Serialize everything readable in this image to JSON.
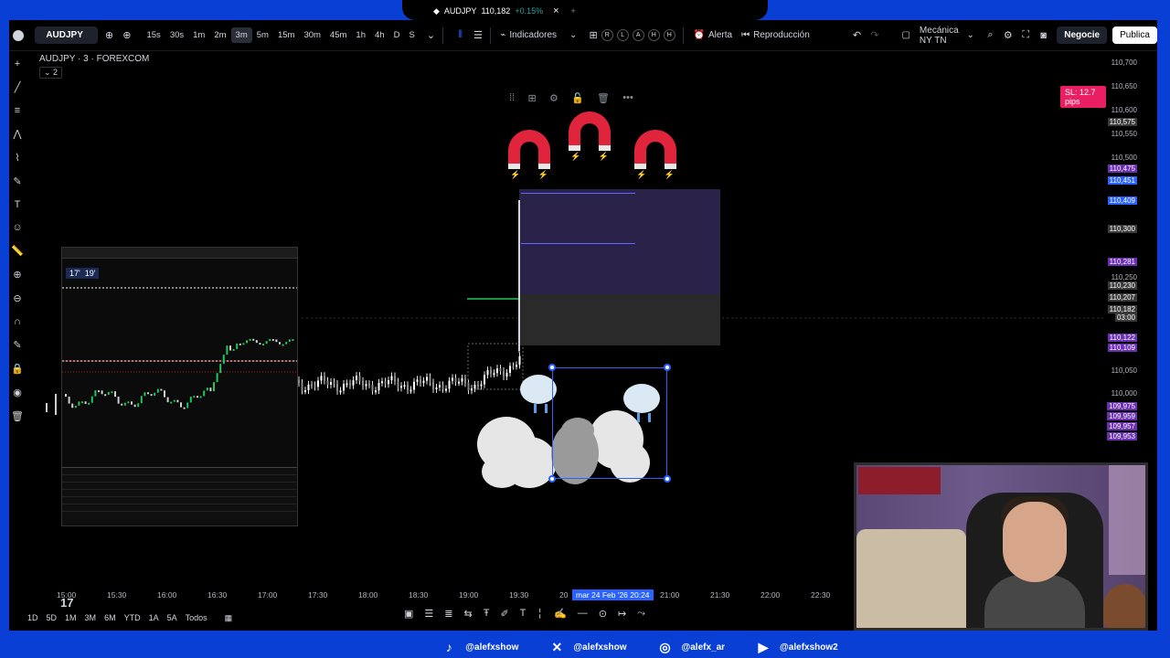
{
  "browser_tab": {
    "title": "AUDJPY",
    "price": "110,182",
    "change": "+0.15%",
    "close_icon": "close-icon",
    "new_tab_icon": "plus-icon"
  },
  "toolbar": {
    "symbol": "AUDJPY",
    "intervals": [
      "15s",
      "30s",
      "1m",
      "2m",
      "3m",
      "5m",
      "15m",
      "30m",
      "45m",
      "1h",
      "4h",
      "D",
      "S"
    ],
    "active_interval": "3m",
    "indicators_label": "Indicadores",
    "small_buttons": [
      "R",
      "L",
      "A",
      "H",
      "H"
    ],
    "alert_label": "Alerta",
    "replay_label": "Reproducción",
    "layout_label": "Mecánica NY TN",
    "trade_label": "Negocie",
    "publish_label": "Publica"
  },
  "chart": {
    "title": "AUDJPY · 3 · FOREXCOM",
    "sub_label": "2",
    "sl_badge": "SL: 12.7 pips"
  },
  "price_axis": {
    "labels": [
      "110,700",
      "110,650",
      "110,600",
      "110,550",
      "110,500",
      "110,350",
      "110,250",
      "110,050",
      "110,000"
    ],
    "tags": [
      {
        "value": "110,575",
        "color": "#3a3a3a"
      },
      {
        "value": "110,475",
        "color": "#6a2fb3"
      },
      {
        "value": "110,451",
        "color": "#2962ff"
      },
      {
        "value": "110,409",
        "color": "#2962ff"
      },
      {
        "value": "110,300",
        "color": "#3a3a3a"
      },
      {
        "value": "110,281",
        "color": "#6a2fb3"
      },
      {
        "value": "110,230",
        "color": "#3a3a3a"
      },
      {
        "value": "110,207",
        "color": "#3a3a3a"
      },
      {
        "value": "110,182",
        "color": "#3a3a3a"
      },
      {
        "value": "03:00",
        "color": "#3a3a3a"
      },
      {
        "value": "110,122",
        "color": "#6a2fb3"
      },
      {
        "value": "110,109",
        "color": "#6a2fb3"
      },
      {
        "value": "109,975",
        "color": "#6a2fb3"
      },
      {
        "value": "109,959",
        "color": "#6a2fb3"
      },
      {
        "value": "109,957",
        "color": "#6a2fb3"
      },
      {
        "value": "109,953",
        "color": "#6a2fb3"
      }
    ]
  },
  "time_axis": {
    "labels": [
      "15:00",
      "15:30",
      "16:00",
      "16:30",
      "17:00",
      "17:30",
      "18:00",
      "18:30",
      "19:00",
      "19:30",
      "20",
      "21:00",
      "21:30",
      "22:00",
      "22:30"
    ],
    "cursor": "mar 24 Feb '26   20:24"
  },
  "bottom_bar": {
    "ranges": [
      "1D",
      "5D",
      "1M",
      "3M",
      "6M",
      "YTD",
      "1A",
      "5A",
      "Todos"
    ]
  },
  "embedded": {
    "clock_a": "17'",
    "clock_b": "19'"
  },
  "social": [
    {
      "icon": "tiktok-icon",
      "glyph": "♪",
      "handle": "@alefxshow"
    },
    {
      "icon": "x-icon",
      "glyph": "✕",
      "handle": "@alefxshow"
    },
    {
      "icon": "instagram-icon",
      "glyph": "◎",
      "handle": "@alefx_ar"
    },
    {
      "icon": "youtube-icon",
      "glyph": "▶",
      "handle": "@alefxshow2"
    }
  ],
  "colors": {
    "frame": "#0a3fd6",
    "magnet": "#e0243c",
    "sl_badge": "#e91e63",
    "selection": "#2962ff"
  }
}
